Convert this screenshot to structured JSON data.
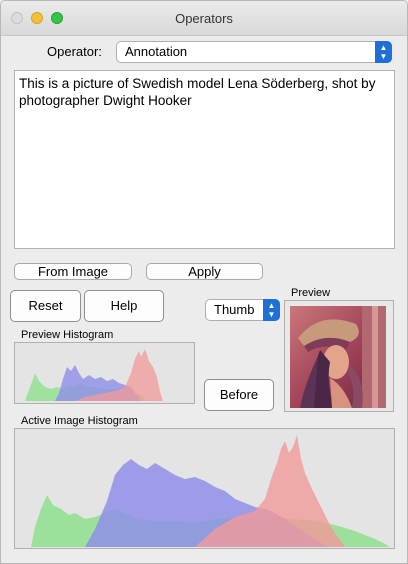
{
  "window": {
    "title": "Operators"
  },
  "operator": {
    "label": "Operator:",
    "value": "Annotation"
  },
  "annotation_text": "This is a picture of Swedish model Lena Söderberg, shot by photographer Dwight Hooker",
  "buttons": {
    "from_image": "From Image",
    "apply": "Apply",
    "reset": "Reset",
    "help": "Help",
    "before": "Before"
  },
  "thumb_select": {
    "value": "Thumb"
  },
  "preview": {
    "label": "Preview"
  },
  "preview_histogram": {
    "label": "Preview Histogram"
  },
  "active_histogram": {
    "label": "Active Image Histogram"
  },
  "colors": {
    "red": "#f39a9a",
    "green": "#8ee08e",
    "blue": "#8f8fea",
    "accent": "#1f6fd6"
  }
}
